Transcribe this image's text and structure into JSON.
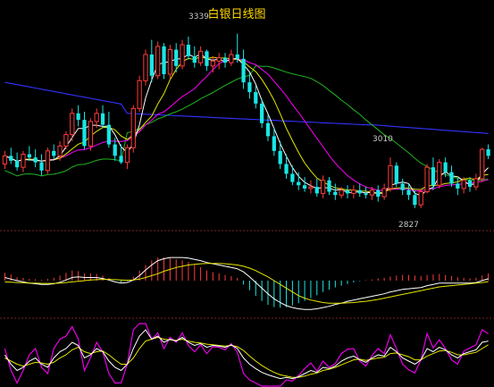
{
  "chart_data": {
    "type": "candlestick",
    "title": "白银日线图",
    "annotations": {
      "high_label": "3339",
      "low_label": "2827",
      "ma_label": "3010"
    },
    "colors": {
      "up": "#ff3c3c",
      "down": "#19e6e6",
      "ma_white": "#ffffff",
      "ma_yellow": "#e6e600",
      "ma_magenta": "#e600e6",
      "ma_green": "#22b422",
      "ma_blue": "#3232ff",
      "macd_dif": "#ffffff",
      "macd_dea": "#e6e600",
      "kdj_k": "#ffffff",
      "kdj_d": "#e6e600",
      "kdj_j": "#e600e6"
    },
    "price_range": [
      2780,
      3420
    ],
    "candles": [
      [
        2940,
        2980,
        2925,
        2965
      ],
      [
        2965,
        2990,
        2940,
        2950
      ],
      [
        2950,
        2975,
        2920,
        2930
      ],
      [
        2930,
        2980,
        2915,
        2970
      ],
      [
        2970,
        2995,
        2950,
        2960
      ],
      [
        2960,
        2985,
        2930,
        2945
      ],
      [
        2945,
        2970,
        2905,
        2920
      ],
      [
        2920,
        2990,
        2910,
        2980
      ],
      [
        2980,
        3000,
        2955,
        2965
      ],
      [
        2965,
        3010,
        2950,
        2995
      ],
      [
        2995,
        3040,
        2985,
        3030
      ],
      [
        3030,
        3110,
        3010,
        3095
      ],
      [
        3095,
        3120,
        3055,
        3075
      ],
      [
        3075,
        3100,
        2985,
        2995
      ],
      [
        2995,
        3080,
        2980,
        3070
      ],
      [
        3070,
        3110,
        3050,
        3095
      ],
      [
        3095,
        3120,
        3050,
        3060
      ],
      [
        3060,
        3100,
        2990,
        3000
      ],
      [
        3000,
        3020,
        2950,
        2965
      ],
      [
        2965,
        3000,
        2940,
        2945
      ],
      [
        2945,
        3000,
        2925,
        2990
      ],
      [
        2990,
        3120,
        2975,
        3110
      ],
      [
        3110,
        3210,
        3100,
        3195
      ],
      [
        3195,
        3290,
        3180,
        3275
      ],
      [
        3275,
        3320,
        3190,
        3210
      ],
      [
        3210,
        3315,
        3200,
        3300
      ],
      [
        3300,
        3310,
        3200,
        3215
      ],
      [
        3215,
        3305,
        3200,
        3290
      ],
      [
        3290,
        3310,
        3220,
        3240
      ],
      [
        3240,
        3320,
        3230,
        3305
      ],
      [
        3305,
        3330,
        3260,
        3270
      ],
      [
        3270,
        3300,
        3235,
        3250
      ],
      [
        3250,
        3300,
        3240,
        3285
      ],
      [
        3285,
        3290,
        3225,
        3240
      ],
      [
        3240,
        3270,
        3220,
        3255
      ],
      [
        3255,
        3280,
        3230,
        3265
      ],
      [
        3265,
        3280,
        3235,
        3250
      ],
      [
        3250,
        3290,
        3240,
        3275
      ],
      [
        3275,
        3339,
        3250,
        3262
      ],
      [
        3262,
        3290,
        3170,
        3190
      ],
      [
        3190,
        3220,
        3140,
        3160
      ],
      [
        3160,
        3180,
        3110,
        3125
      ],
      [
        3125,
        3140,
        3050,
        3065
      ],
      [
        3065,
        3090,
        3010,
        3025
      ],
      [
        3025,
        3050,
        2965,
        2980
      ],
      [
        2980,
        3010,
        2925,
        2940
      ],
      [
        2940,
        2970,
        2895,
        2910
      ],
      [
        2910,
        2935,
        2875,
        2885
      ],
      [
        2885,
        2915,
        2860,
        2875
      ],
      [
        2875,
        2900,
        2855,
        2865
      ],
      [
        2865,
        2890,
        2850,
        2870
      ],
      [
        2870,
        2895,
        2840,
        2850
      ],
      [
        2850,
        2905,
        2835,
        2890
      ],
      [
        2890,
        2900,
        2845,
        2855
      ],
      [
        2855,
        2880,
        2830,
        2845
      ],
      [
        2845,
        2870,
        2835,
        2860
      ],
      [
        2860,
        2875,
        2835,
        2850
      ],
      [
        2850,
        2875,
        2835,
        2860
      ],
      [
        2860,
        2880,
        2840,
        2850
      ],
      [
        2850,
        2870,
        2835,
        2845
      ],
      [
        2845,
        2870,
        2830,
        2860
      ],
      [
        2860,
        2875,
        2825,
        2840
      ],
      [
        2840,
        2880,
        2830,
        2865
      ],
      [
        2865,
        2960,
        2855,
        2935
      ],
      [
        2935,
        2945,
        2870,
        2880
      ],
      [
        2880,
        2895,
        2845,
        2860
      ],
      [
        2860,
        2880,
        2830,
        2845
      ],
      [
        2845,
        2860,
        2805,
        2815
      ],
      [
        2815,
        2865,
        2805,
        2855
      ],
      [
        2855,
        2940,
        2850,
        2930
      ],
      [
        2930,
        2960,
        2860,
        2875
      ],
      [
        2875,
        2955,
        2865,
        2945
      ],
      [
        2945,
        2960,
        2900,
        2915
      ],
      [
        2915,
        2935,
        2870,
        2880
      ],
      [
        2880,
        2895,
        2845,
        2865
      ],
      [
        2865,
        2900,
        2850,
        2890
      ],
      [
        2890,
        2900,
        2855,
        2870
      ],
      [
        2870,
        2910,
        2860,
        2895
      ],
      [
        2895,
        2990,
        2885,
        2985
      ],
      [
        2985,
        3000,
        2955,
        2965
      ]
    ],
    "macd": {
      "hist": [
        0.28,
        0.22,
        0.12,
        0.1,
        0.06,
        0.05,
        0.03,
        0.06,
        0.1,
        0.18,
        0.28,
        0.36,
        0.34,
        0.26,
        0.26,
        0.24,
        0.18,
        0.1,
        0,
        -0.06,
        -0.02,
        0.14,
        0.36,
        0.56,
        0.72,
        0.82,
        0.82,
        0.8,
        0.76,
        0.72,
        0.66,
        0.56,
        0.48,
        0.36,
        0.3,
        0.26,
        0.2,
        0.16,
        0.1,
        -0.14,
        -0.34,
        -0.54,
        -0.72,
        -0.86,
        -0.94,
        -0.96,
        -0.94,
        -0.88,
        -0.8,
        -0.72,
        -0.62,
        -0.52,
        -0.4,
        -0.32,
        -0.24,
        -0.18,
        -0.12,
        -0.06,
        -0.02,
        0.02,
        0.04,
        0.08,
        0.1,
        0.14,
        0.18,
        0.2,
        0.2,
        0.18,
        0.16,
        0.2,
        0.22,
        0.24,
        0.2,
        0.16,
        0.12,
        0.1,
        0.08,
        0.1,
        0.18,
        0.26
      ],
      "dif": [
        0.1,
        0.05,
        0,
        -0.04,
        -0.08,
        -0.1,
        -0.12,
        -0.12,
        -0.1,
        -0.05,
        0.02,
        0.1,
        0.12,
        0.1,
        0.1,
        0.1,
        0.07,
        0.02,
        -0.04,
        -0.08,
        -0.06,
        0.02,
        0.16,
        0.34,
        0.5,
        0.64,
        0.7,
        0.74,
        0.74,
        0.74,
        0.72,
        0.68,
        0.64,
        0.58,
        0.54,
        0.5,
        0.46,
        0.42,
        0.38,
        0.28,
        0.12,
        -0.06,
        -0.24,
        -0.42,
        -0.58,
        -0.7,
        -0.8,
        -0.86,
        -0.9,
        -0.92,
        -0.92,
        -0.9,
        -0.86,
        -0.82,
        -0.76,
        -0.72,
        -0.66,
        -0.62,
        -0.58,
        -0.54,
        -0.5,
        -0.46,
        -0.42,
        -0.36,
        -0.32,
        -0.28,
        -0.26,
        -0.24,
        -0.22,
        -0.16,
        -0.12,
        -0.08,
        -0.08,
        -0.08,
        -0.08,
        -0.08,
        -0.08,
        -0.06,
        0,
        0.06
      ],
      "dea": [
        -0.04,
        -0.05,
        -0.06,
        -0.07,
        -0.08,
        -0.08,
        -0.09,
        -0.09,
        -0.09,
        -0.08,
        -0.06,
        -0.04,
        -0.02,
        0,
        0.02,
        0.03,
        0.04,
        0.04,
        0.03,
        0.02,
        0.01,
        0.02,
        0.05,
        0.1,
        0.16,
        0.22,
        0.3,
        0.36,
        0.42,
        0.46,
        0.5,
        0.52,
        0.54,
        0.55,
        0.55,
        0.55,
        0.54,
        0.52,
        0.5,
        0.46,
        0.4,
        0.32,
        0.22,
        0.12,
        0,
        -0.12,
        -0.24,
        -0.36,
        -0.48,
        -0.56,
        -0.62,
        -0.66,
        -0.7,
        -0.72,
        -0.72,
        -0.72,
        -0.71,
        -0.7,
        -0.68,
        -0.66,
        -0.63,
        -0.6,
        -0.56,
        -0.52,
        -0.48,
        -0.44,
        -0.4,
        -0.36,
        -0.32,
        -0.28,
        -0.24,
        -0.2,
        -0.18,
        -0.16,
        -0.14,
        -0.12,
        -0.1,
        -0.08,
        -0.06,
        -0.03
      ]
    },
    "kdj": {
      "k": [
        50,
        35,
        25,
        30,
        40,
        45,
        35,
        30,
        45,
        55,
        60,
        70,
        65,
        45,
        50,
        60,
        55,
        40,
        30,
        25,
        35,
        60,
        80,
        90,
        75,
        80,
        70,
        75,
        72,
        78,
        70,
        65,
        68,
        62,
        65,
        64,
        62,
        66,
        60,
        45,
        35,
        28,
        22,
        18,
        15,
        12,
        14,
        12,
        15,
        20,
        25,
        22,
        30,
        28,
        32,
        40,
        45,
        48,
        42,
        38,
        45,
        50,
        48,
        62,
        55,
        45,
        40,
        35,
        42,
        60,
        55,
        62,
        58,
        50,
        45,
        52,
        55,
        58,
        70,
        72
      ],
      "d": [
        45,
        40,
        35,
        32,
        35,
        38,
        37,
        35,
        38,
        45,
        50,
        58,
        62,
        55,
        52,
        55,
        56,
        50,
        42,
        35,
        35,
        45,
        60,
        72,
        75,
        78,
        75,
        74,
        73,
        75,
        72,
        70,
        69,
        67,
        66,
        65,
        64,
        65,
        63,
        57,
        48,
        40,
        33,
        27,
        22,
        18,
        16,
        14,
        14,
        16,
        19,
        21,
        25,
        27,
        30,
        34,
        38,
        42,
        43,
        41,
        43,
        45,
        46,
        52,
        53,
        50,
        47,
        42,
        42,
        48,
        52,
        56,
        57,
        54,
        50,
        50,
        52,
        54,
        60,
        66
      ],
      "j": [
        60,
        25,
        5,
        25,
        50,
        60,
        30,
        20,
        60,
        75,
        80,
        95,
        75,
        25,
        45,
        70,
        55,
        20,
        5,
        5,
        35,
        90,
        100,
        100,
        75,
        85,
        60,
        78,
        70,
        85,
        65,
        55,
        66,
        52,
        63,
        62,
        58,
        68,
        54,
        20,
        10,
        5,
        0,
        0,
        0,
        0,
        10,
        8,
        17,
        28,
        37,
        24,
        40,
        30,
        36,
        52,
        59,
        60,
        40,
        32,
        49,
        60,
        52,
        82,
        60,
        35,
        26,
        21,
        42,
        84,
        61,
        74,
        60,
        42,
        35,
        56,
        61,
        66,
        90,
        84
      ]
    }
  }
}
